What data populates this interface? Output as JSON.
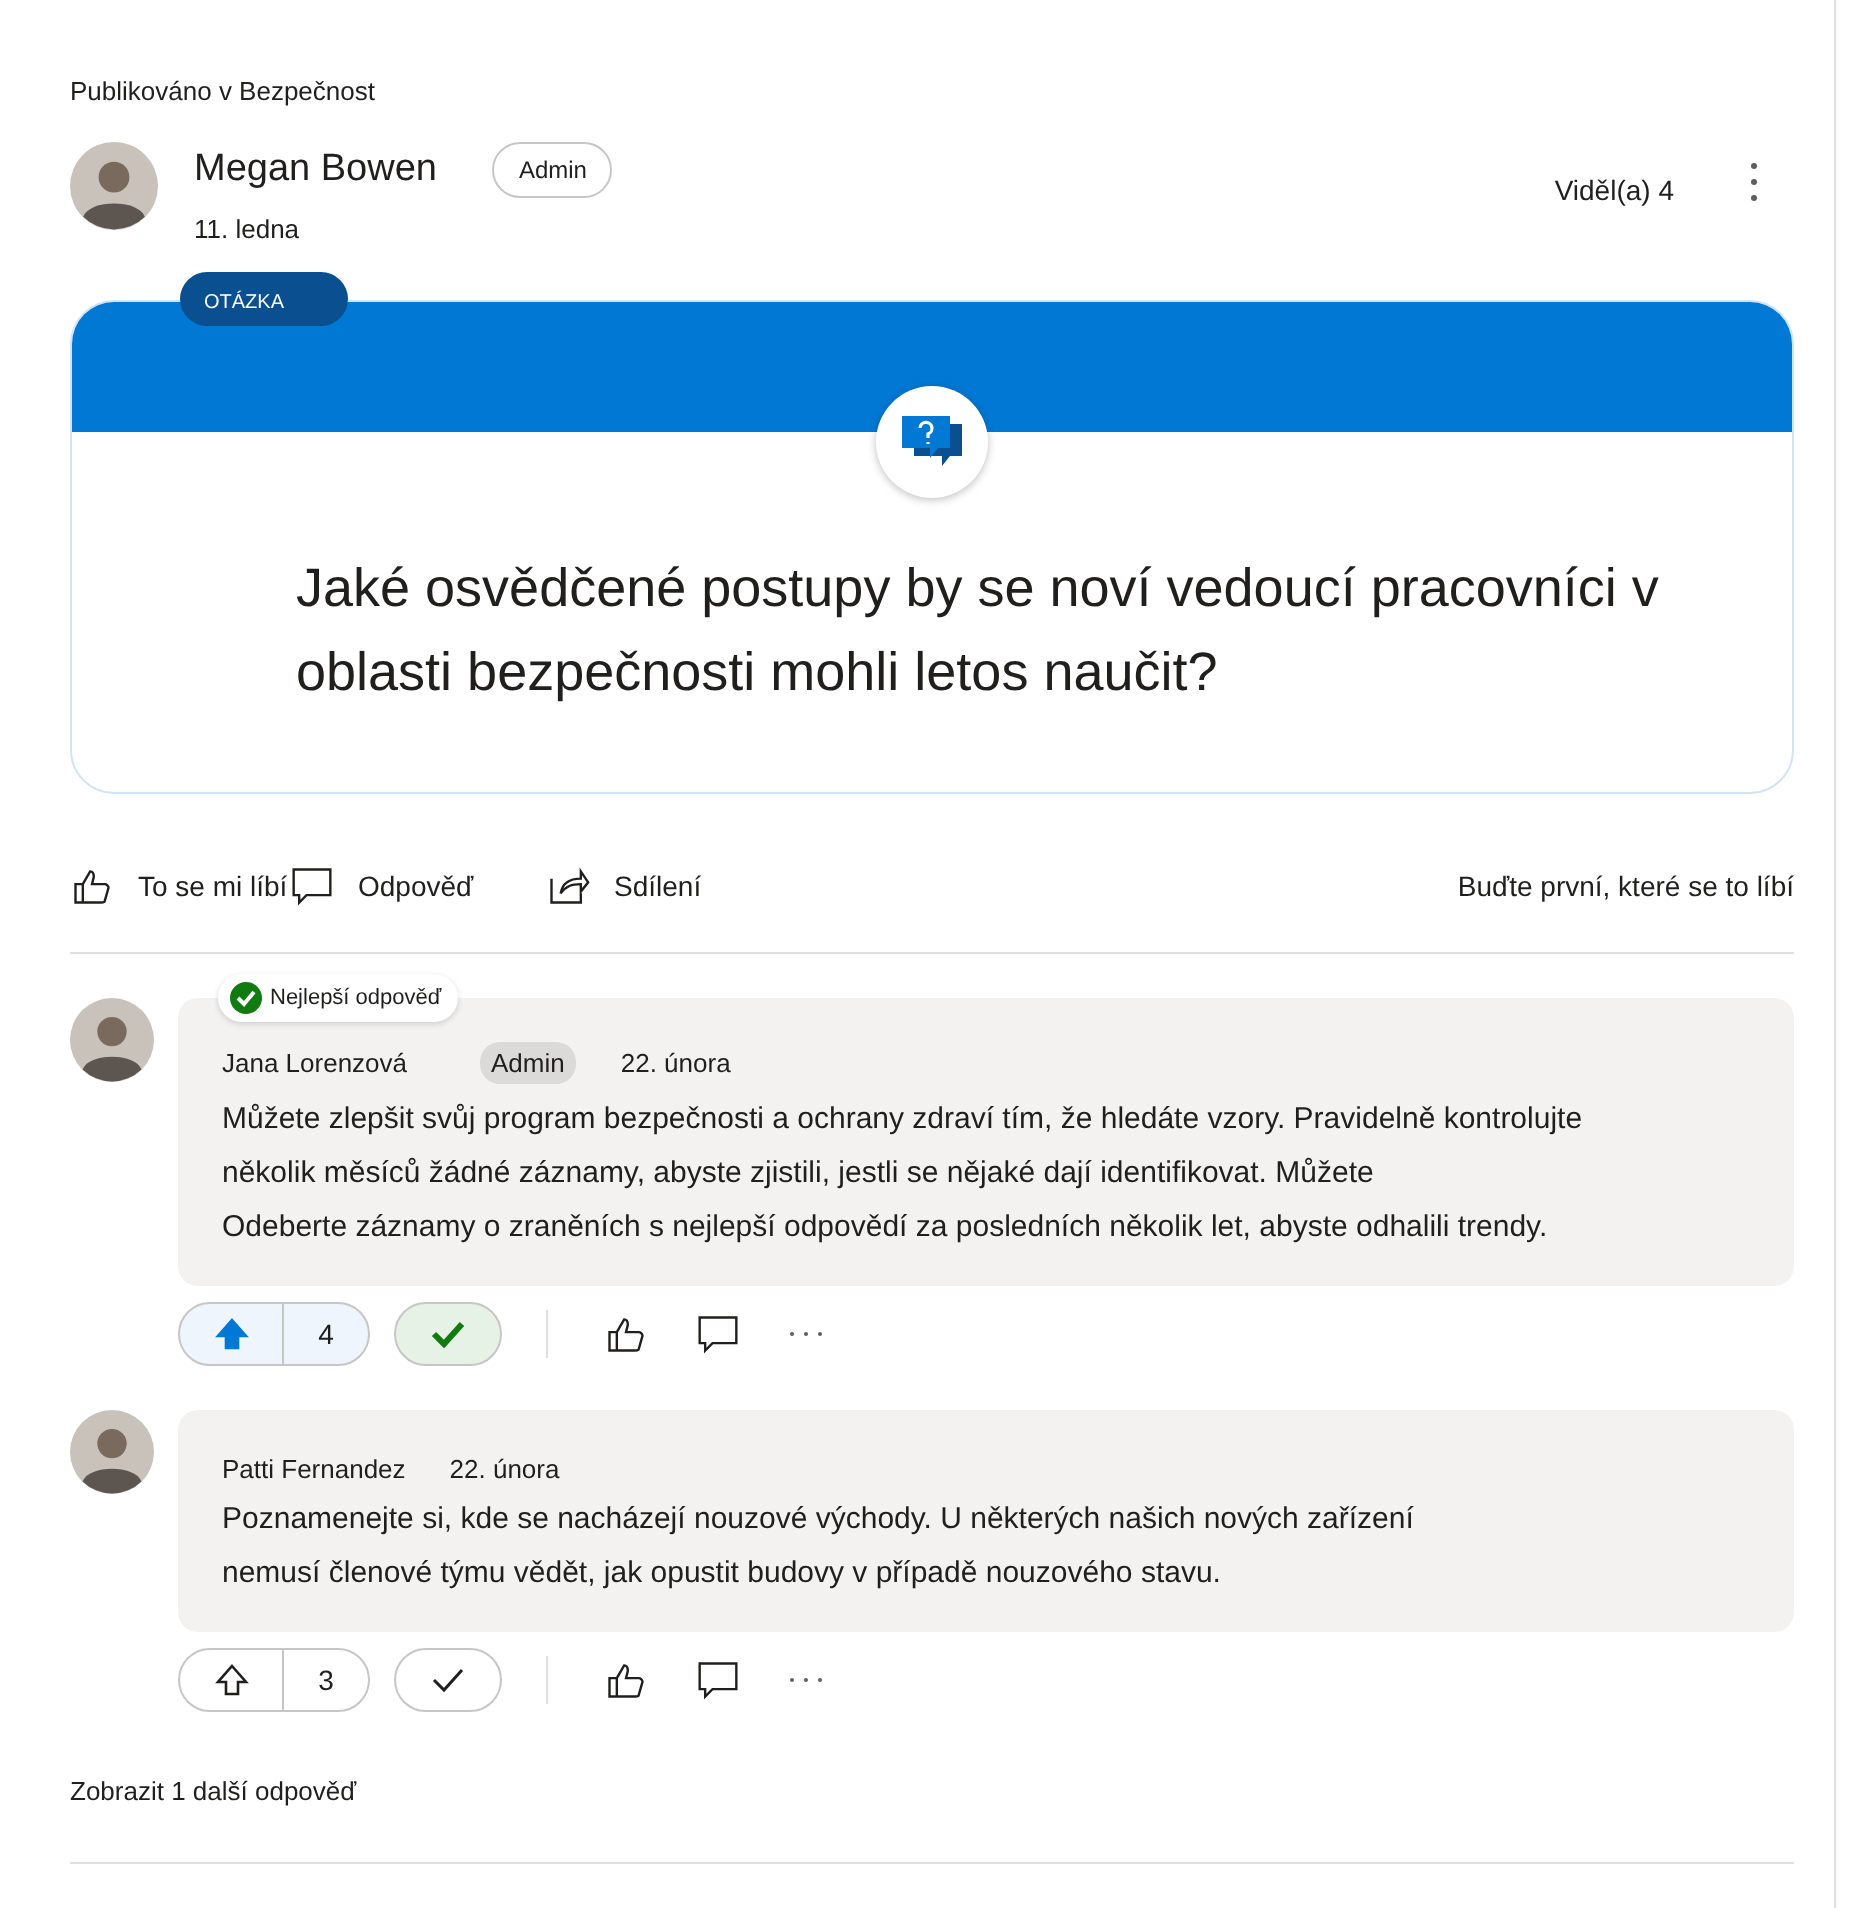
{
  "posted_in": "Publikováno v Bezpečnost",
  "author": {
    "name": "Megan Bowen",
    "badge": "Admin",
    "date": "11. ledna"
  },
  "views": "Viděl(a) 4",
  "question": {
    "tag": "OTÁZKA",
    "text": "Jaké osvědčené postupy by se noví vedoucí pracovníci v oblasti bezpečnosti mohli letos naučit?"
  },
  "actions": [
    {
      "kind": "like",
      "label": "To se mi líbí"
    },
    {
      "kind": "reply",
      "label": "Odpověď"
    },
    {
      "kind": "share",
      "label": "Sdílení"
    }
  ],
  "like_summary": "Buďte první, které se to líbí",
  "replies": [
    {
      "best_label": "Nejlepší odpověď",
      "name": "Jana Lorenzová",
      "badge": "Admin",
      "date": "22. února",
      "lines": [
        "Můžete zlepšit svůj program bezpečnosti a ochrany zdraví tím, že hledáte vzory. Pravidelně kontrolujte",
        "několik měsíců žádné záznamy, abyste zjistili, jestli se nějaké dají identifikovat. Můžete",
        "Odeberte záznamy o zraněních s nejlepší odpovědí za posledních několik let, abyste odhalili trendy."
      ],
      "votes": "4",
      "upvoted": true,
      "best": true
    },
    {
      "name": "Patti Fernandez",
      "date": "22. února",
      "lines": [
        "Poznamenejte si, kde se nacházejí nouzové východy. U některých našich nových zařízení",
        "nemusí členové týmu vědět, jak opustit budovy v případě nouzového stavu."
      ],
      "votes": "3",
      "upvoted": false,
      "best": false
    }
  ],
  "more": "Zobrazit 1 další odpověď"
}
